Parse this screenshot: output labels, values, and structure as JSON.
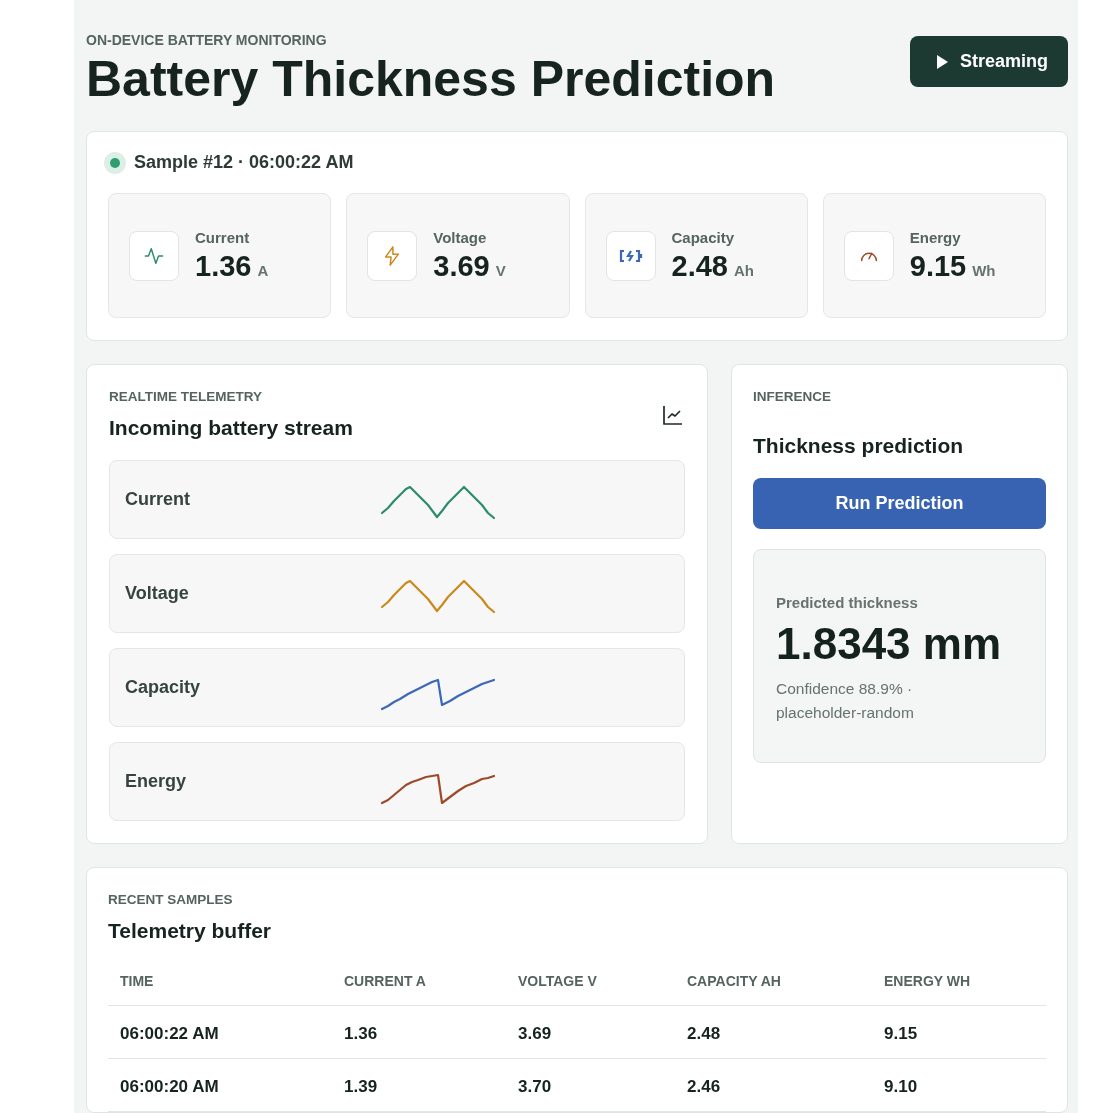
{
  "header": {
    "eyebrow": "ON-DEVICE BATTERY MONITORING",
    "title": "Battery Thickness Prediction",
    "stream_button": {
      "label": "Streaming"
    }
  },
  "sample": {
    "label": "Sample #12 · 06:00:22 AM"
  },
  "metrics": [
    {
      "kind": "current",
      "label": "Current",
      "value": "1.36",
      "unit": "A",
      "color": "#2e8b6a"
    },
    {
      "kind": "voltage",
      "label": "Voltage",
      "value": "3.69",
      "unit": "V",
      "color": "#c98a1e"
    },
    {
      "kind": "capacity",
      "label": "Capacity",
      "value": "2.48",
      "unit": "Ah",
      "color": "#3d67b8"
    },
    {
      "kind": "energy",
      "label": "Energy",
      "value": "9.15",
      "unit": "Wh",
      "color": "#9c4a2a"
    }
  ],
  "telemetry": {
    "eyebrow": "REALTIME TELEMETRY",
    "title": "Incoming battery stream",
    "streams": [
      {
        "label": "Current",
        "kind": "wave",
        "color": "#2e8b6a"
      },
      {
        "label": "Voltage",
        "kind": "wave",
        "color": "#c98a1e"
      },
      {
        "label": "Capacity",
        "kind": "ramp",
        "color": "#3d67b8"
      },
      {
        "label": "Energy",
        "kind": "ramp",
        "color": "#9c4a2a"
      }
    ]
  },
  "inference": {
    "eyebrow": "INFERENCE",
    "title": "Thickness prediction",
    "button": "Run Prediction",
    "result_label": "Predicted thickness",
    "result_value": "1.8343 mm",
    "note": "Confidence 88.9% · placeholder-random"
  },
  "samples": {
    "eyebrow": "RECENT SAMPLES",
    "title": "Telemetry buffer",
    "columns": [
      "TIME",
      "CURRENT A",
      "VOLTAGE V",
      "CAPACITY AH",
      "ENERGY WH"
    ],
    "rows": [
      [
        "06:00:22 AM",
        "1.36",
        "3.69",
        "2.48",
        "9.15"
      ],
      [
        "06:00:20 AM",
        "1.39",
        "3.70",
        "2.46",
        "9.10"
      ]
    ]
  }
}
